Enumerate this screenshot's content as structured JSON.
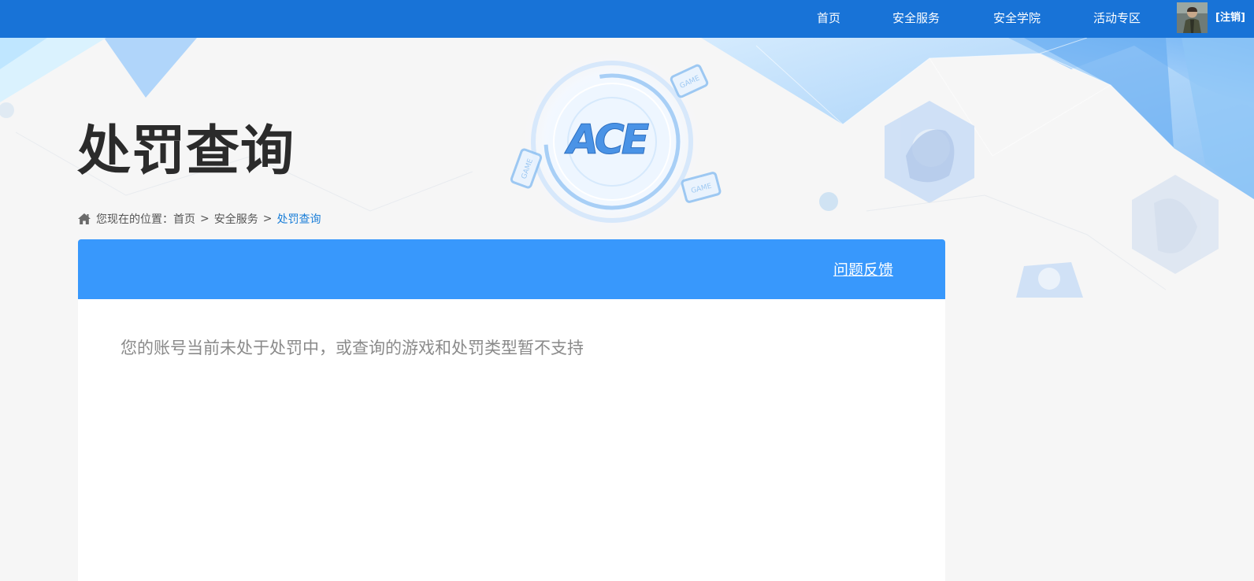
{
  "nav": {
    "items": [
      "首页",
      "安全服务",
      "安全学院",
      "活动专区"
    ],
    "logout_label": "[注销]"
  },
  "banner": {
    "logo_text": "ACE",
    "device_tag": "GAME"
  },
  "page": {
    "title": "处罚查询"
  },
  "breadcrumb": {
    "prefix": "您现在的位置：",
    "items": [
      "首页",
      "安全服务"
    ],
    "separator": ">",
    "current": "处罚查询"
  },
  "card": {
    "feedback_label": "问题反馈",
    "status_message": "您的账号当前未处于处罚中，或查询的游戏和处罚类型暂不支持"
  },
  "colors": {
    "nav_bg": "#1873d7",
    "card_header_bg": "#3898fc",
    "breadcrumb_current": "#1c7fd8",
    "page_bg": "#f6f6f6"
  },
  "icons": {
    "breadcrumb": "home-icon",
    "avatar": "avatar-image"
  }
}
